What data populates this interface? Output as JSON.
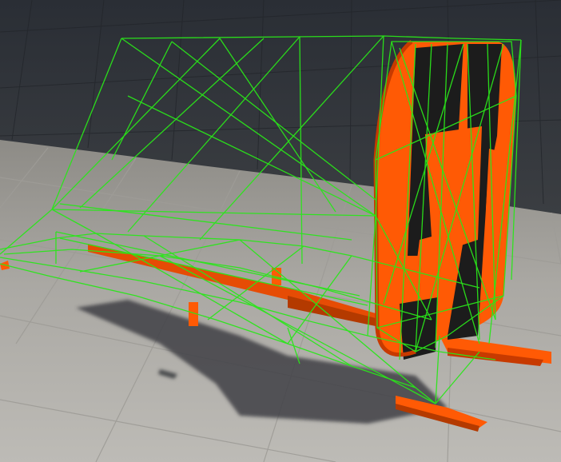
{
  "scene": {
    "description_name": "3d-viewport",
    "colors": {
      "wall_top": "#2b2f36",
      "wall_bottom": "#3a3d41",
      "floor_near": "#b9b7b2",
      "floor_far": "#8d8b86",
      "tile_line": "#a4a29d",
      "shadow": "#3b3d40",
      "wireframe": "#27e61a",
      "orange": "#ff5a05",
      "dark_orange": "#c73a00",
      "black_panel": "#1b1b1b"
    },
    "icons": {
      "wireframe": "wireframe-mesh-icon",
      "sign": "traffic-sign-icon"
    }
  }
}
